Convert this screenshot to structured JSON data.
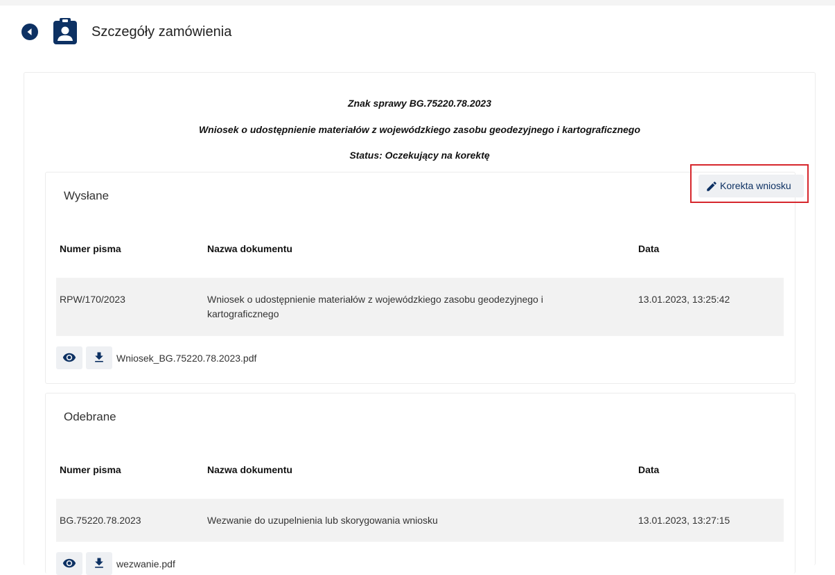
{
  "header": {
    "title": "Szczegóły zamówienia",
    "back_icon": "back-arrow-icon",
    "doc_icon": "clipboard-user-icon"
  },
  "order": {
    "case_number": "Znak sprawy BG.75220.78.2023",
    "request_title": "Wniosek o udostępnienie materiałów z wojewódzkiego zasobu geodezyjnego i kartograficznego",
    "status": "Status: Oczekujący na korektę"
  },
  "actions": {
    "correction_label": "Korekta wniosku",
    "correction_icon": "pencil-icon"
  },
  "sent": {
    "title": "Wysłane",
    "columns": [
      "Numer pisma",
      "Nazwa dokumentu",
      "Data"
    ],
    "rows": [
      {
        "number": "RPW/170/2023",
        "name": "Wniosek o udostępnienie materiałów z wojewódzkiego zasobu geodezyjnego i kartograficznego",
        "date": "13.01.2023, 13:25:42"
      }
    ],
    "file": "Wniosek_BG.75220.78.2023.pdf"
  },
  "received": {
    "title": "Odebrane",
    "columns": [
      "Numer pisma",
      "Nazwa dokumentu",
      "Data"
    ],
    "rows": [
      {
        "number": "BG.75220.78.2023",
        "name": "Wezwanie do uzupelnienia lub skorygowania wniosku",
        "date": "13.01.2023, 13:27:15"
      }
    ],
    "file": "wezwanie.pdf"
  },
  "colors": {
    "primary": "#0d3163",
    "highlight": "#d6262c",
    "row_bg": "#f2f2f2"
  }
}
